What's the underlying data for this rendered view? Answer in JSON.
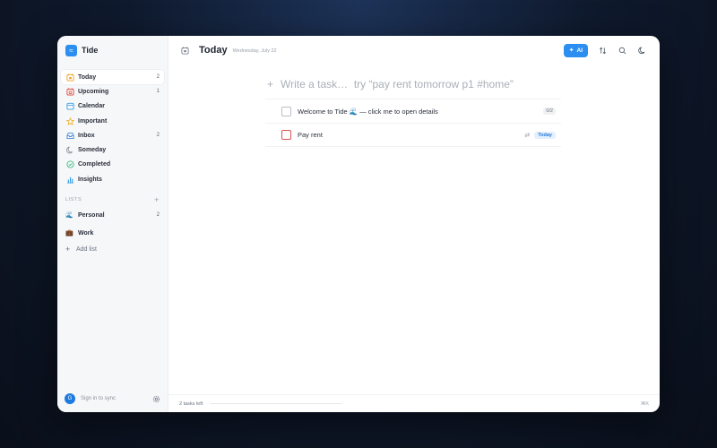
{
  "app": {
    "name": "Tide"
  },
  "sidebar": {
    "nav": [
      {
        "label": "Today",
        "count": "2",
        "icon": "calendar-today-icon",
        "color": "#f0a020"
      },
      {
        "label": "Upcoming",
        "count": "1",
        "icon": "calendar-upcoming-icon",
        "color": "#e0453a"
      },
      {
        "label": "Calendar",
        "count": "",
        "icon": "calendar-icon",
        "color": "#3aa0e8"
      },
      {
        "label": "Important",
        "count": "",
        "icon": "star-icon",
        "color": "#f0b020"
      },
      {
        "label": "Inbox",
        "count": "2",
        "icon": "inbox-icon",
        "color": "#2c7ad6"
      },
      {
        "label": "Someday",
        "count": "",
        "icon": "moon-icon",
        "color": "#8a909a"
      },
      {
        "label": "Completed",
        "count": "",
        "icon": "check-circle-icon",
        "color": "#2bb673"
      },
      {
        "label": "Insights",
        "count": "",
        "icon": "bar-chart-icon",
        "color": "#3aa0e8"
      }
    ],
    "lists_header": "LISTS",
    "lists": [
      {
        "emoji": "🌊",
        "label": "Personal",
        "count": "2"
      },
      {
        "emoji": "💼",
        "label": "Work",
        "count": ""
      }
    ],
    "add_list": "Add list",
    "avatar_initial": "G",
    "sync_text": "Sign in to sync"
  },
  "header": {
    "title": "Today",
    "date": "Wednesday, July 22",
    "ai_label": "AI",
    "accent": "#2c8ef0"
  },
  "composer": {
    "placeholder": "Write a task…  try “pay rent tomorrow p1 #home”"
  },
  "tasks": [
    {
      "title": "Welcome to Tide 🌊 — click me to open details",
      "subtasks": "0/2"
    },
    {
      "title": "Pay rent",
      "badge": "Today",
      "priority_color": "#d9534f"
    }
  ],
  "footer": {
    "tasks_left": "2 tasks left",
    "progress": 0,
    "shortcut": "⌘K"
  }
}
